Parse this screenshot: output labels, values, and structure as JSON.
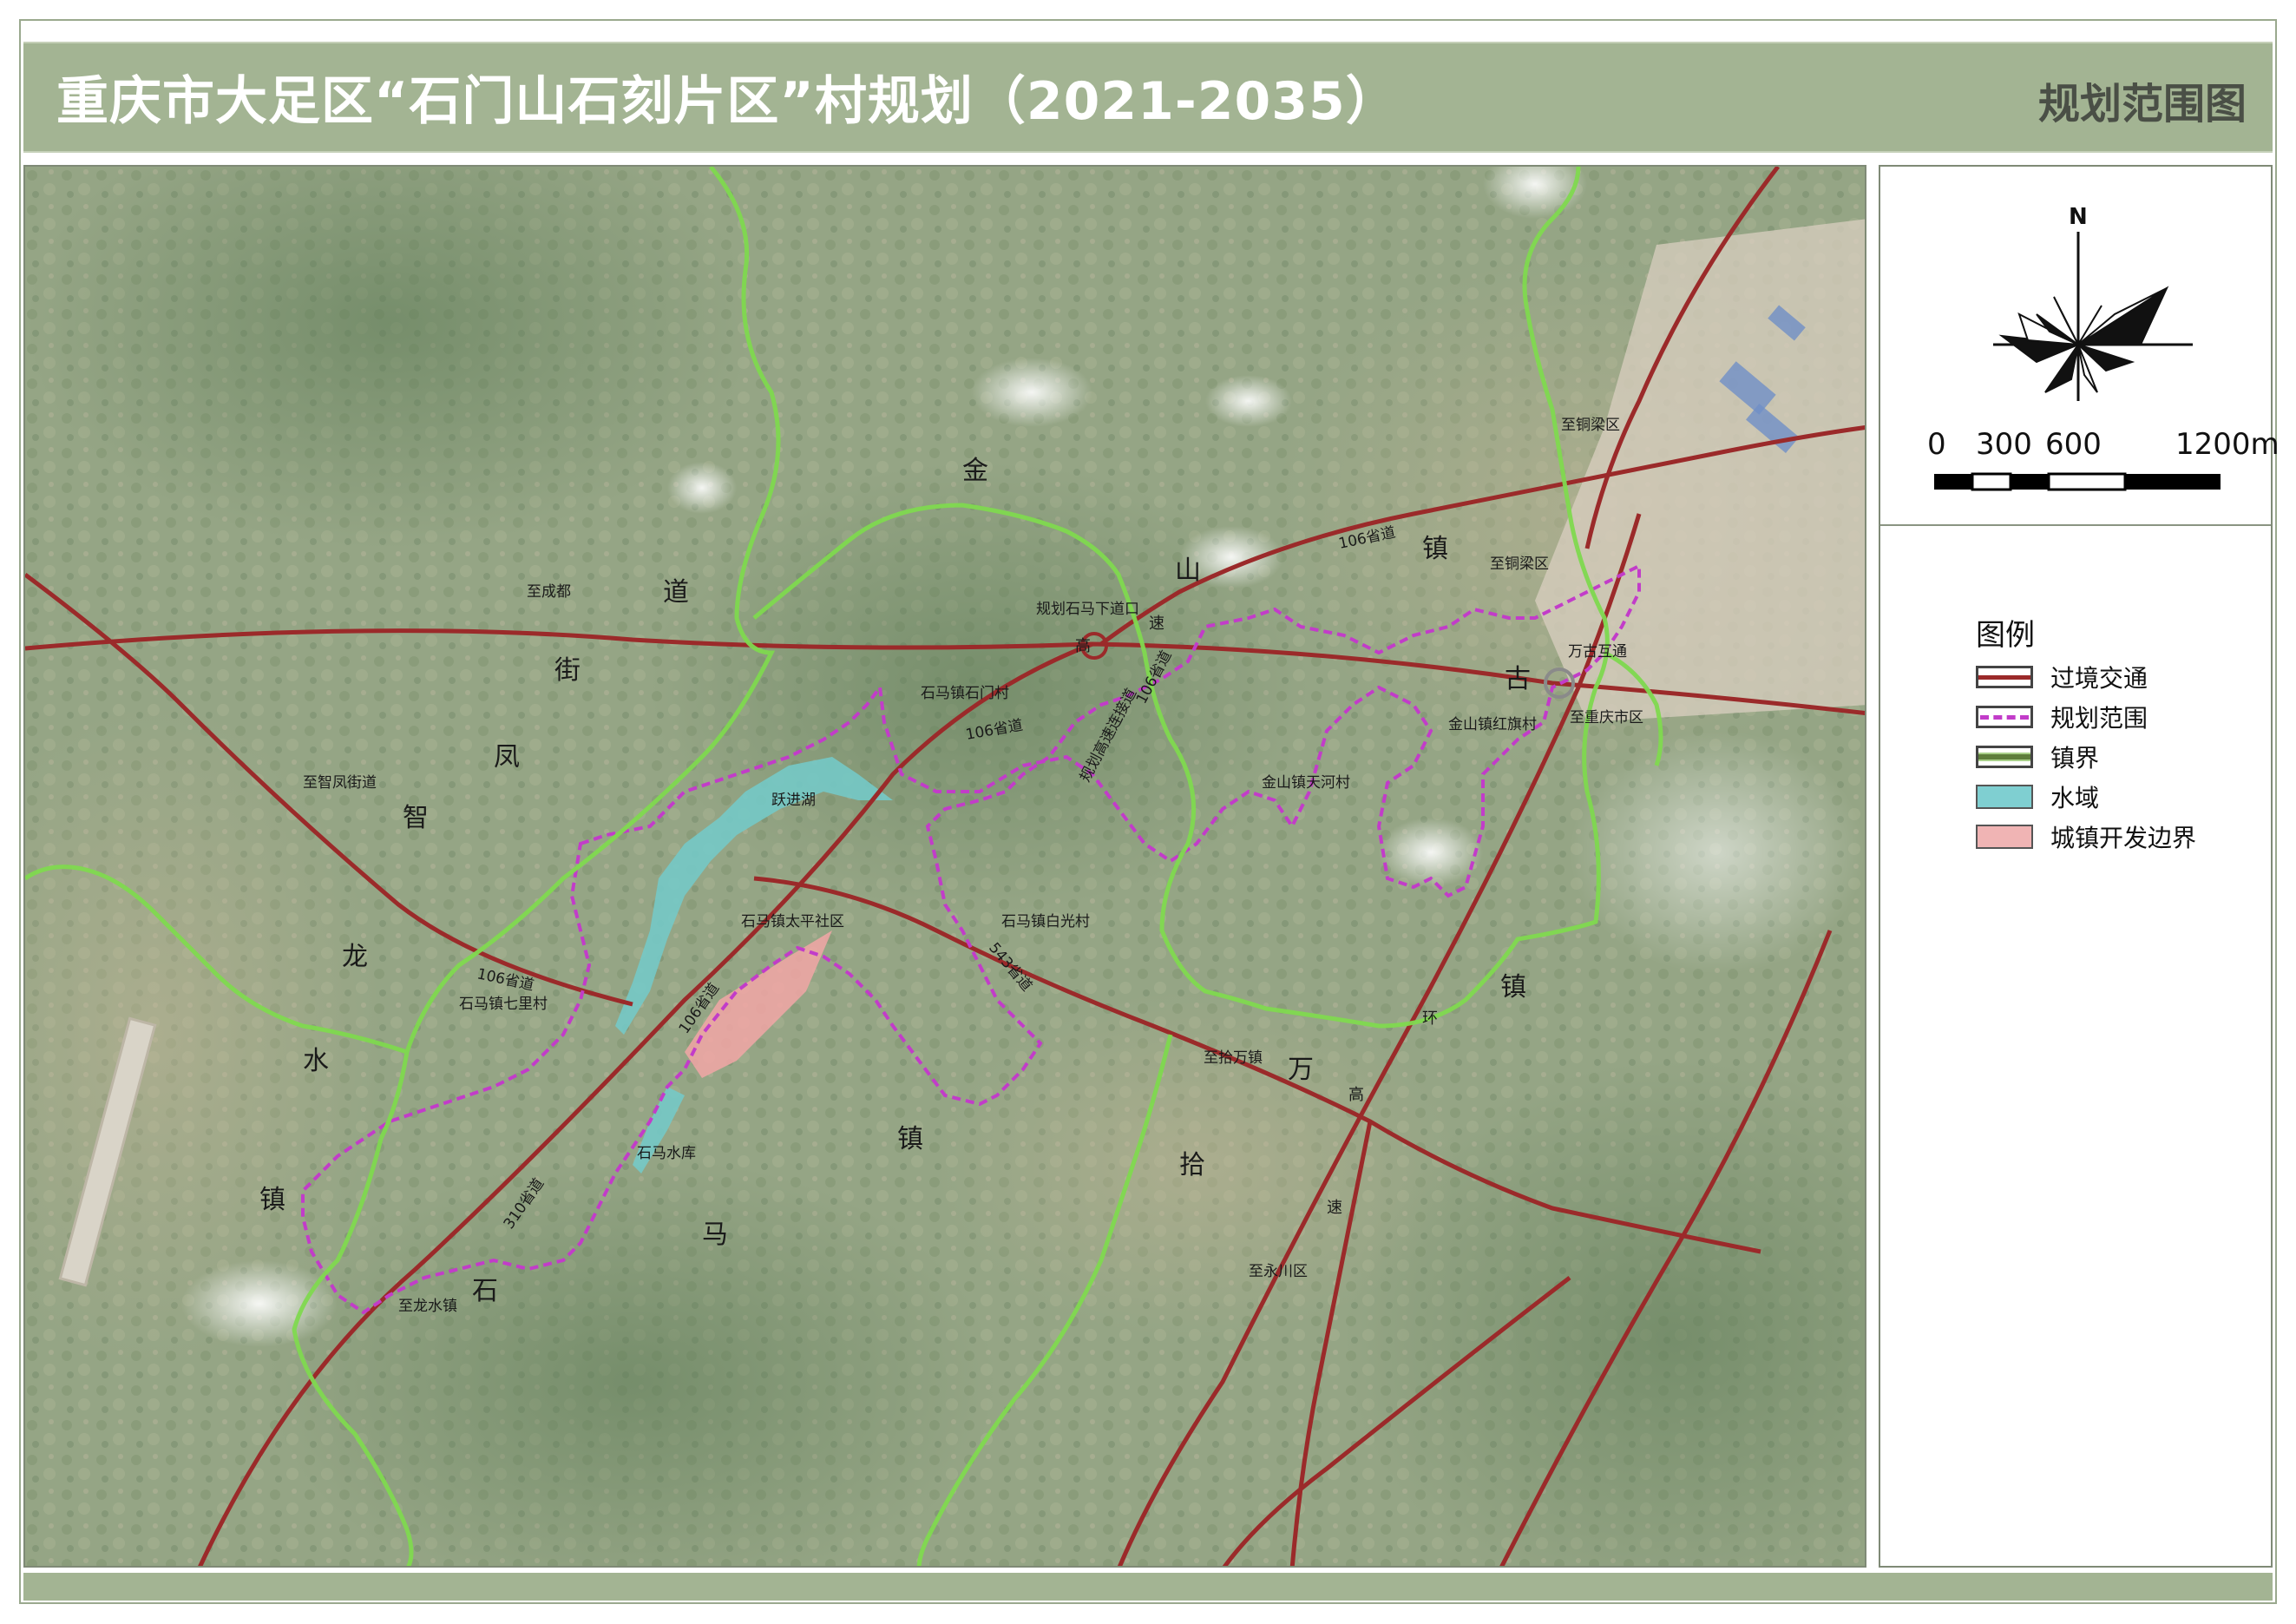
{
  "header": {
    "title": "重庆市大足区“石门山石刻片区”村规划（2021-2035）",
    "subtitle": "规划范围图"
  },
  "map": {
    "town_labels": {
      "jinshan": [
        "金",
        "山",
        "镇"
      ],
      "zhifeng": [
        "智",
        "凤",
        "街",
        "道"
      ],
      "longshui": [
        "龙",
        "水",
        "镇"
      ],
      "shima": [
        "石",
        "马",
        "镇"
      ],
      "wangu": [
        "万",
        "古",
        "镇"
      ],
      "shiwan": [
        "拾",
        "万",
        "镇"
      ],
      "gaosu": [
        "高",
        "速",
        "环",
        "高",
        "速"
      ]
    },
    "place_labels": {
      "to_chengdu": "至成都",
      "to_zhifeng": "至智凤街道",
      "to_longshui": "至龙水镇",
      "to_shiwan": "至拾万镇",
      "to_yongchuan": "至永川区",
      "to_tongliang_1": "至铜梁区",
      "to_tongliang_2": "至铜梁区",
      "to_chongqing": "至重庆市区",
      "wangu_interchange": "万古互通",
      "exit": "规划石马下道口",
      "connector": "规划高速连接道",
      "s106_1": "106省道",
      "s106_2": "106省道",
      "s106_3": "106省道",
      "s106_4": "106省道",
      "s106_5": "106省道",
      "s543": "543省道",
      "s310": "310省道",
      "shimen": "石马镇石门村",
      "yuejin": "跃进湖",
      "taiping": "石马镇太平社区",
      "baiguang": "石马镇白光村",
      "qili": "石马镇七里村",
      "hongqi": "金山镇红旗村",
      "tianhe": "金山镇天河村",
      "shima_reservoir": "石马水库"
    }
  },
  "compass": {
    "north_label": "N"
  },
  "scale_bar": {
    "labels": [
      "0",
      "300",
      "600",
      "1200m"
    ]
  },
  "legend": {
    "title": "图例",
    "items": [
      {
        "label": "过境交通",
        "color": "#9b2a2a"
      },
      {
        "label": "规划范围",
        "color": "#c23cc9"
      },
      {
        "label": "镇界",
        "color": "#5e7d3c"
      },
      {
        "label": "水域",
        "color": "#7fcfd1"
      },
      {
        "label": "城镇开发边界",
        "color": "#f0b4b4"
      }
    ]
  }
}
